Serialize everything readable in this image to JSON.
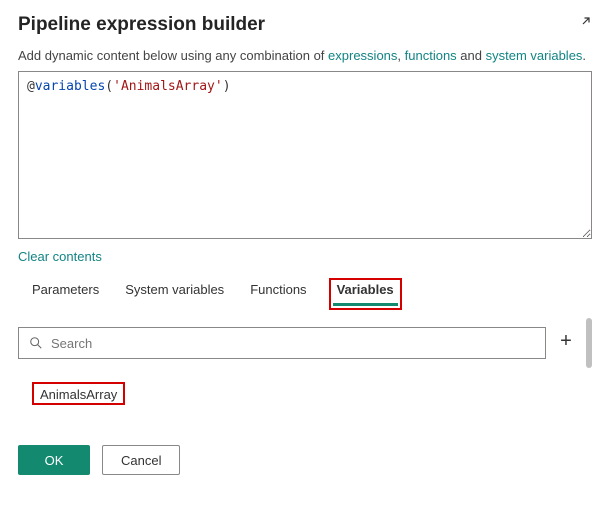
{
  "header": {
    "title": "Pipeline expression builder"
  },
  "subtitle": {
    "prefix": "Add dynamic content below using any combination of ",
    "link1": "expressions",
    "mid1": ", ",
    "link2": "functions",
    "mid2": " and ",
    "link3": "system variables",
    "suffix": "."
  },
  "editor": {
    "at": "@",
    "fn": "variables",
    "open": "(",
    "quote1": "'",
    "str": "AnimalsArray",
    "quote2": "'",
    "close": ")"
  },
  "actions": {
    "clear": "Clear contents"
  },
  "tabs": {
    "parameters": "Parameters",
    "system_variables": "System variables",
    "functions": "Functions",
    "variables": "Variables"
  },
  "search": {
    "placeholder": "Search"
  },
  "variables": {
    "items": [
      {
        "label": "AnimalsArray"
      }
    ]
  },
  "buttons": {
    "ok": "OK",
    "cancel": "Cancel"
  },
  "icons": {
    "expand": "expand-icon",
    "search": "search-icon",
    "plus": "plus-icon"
  }
}
